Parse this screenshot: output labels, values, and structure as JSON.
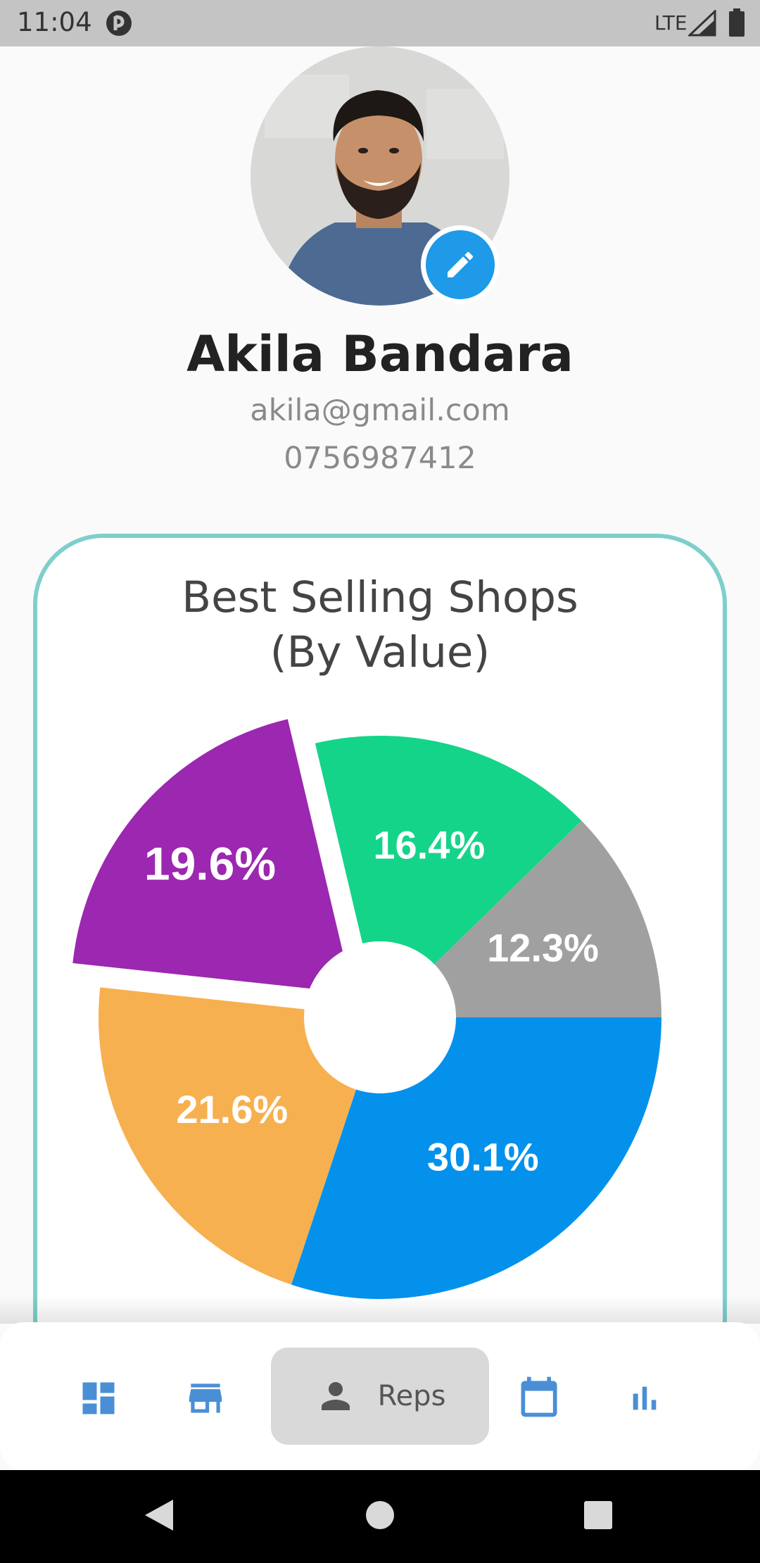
{
  "status_bar": {
    "time": "11:04",
    "network": "LTE"
  },
  "profile": {
    "name": "Akila Bandara",
    "email": "akila@gmail.com",
    "phone": "0756987412"
  },
  "chart": {
    "title_line1": "Best Selling Shops",
    "title_line2": "(By Value)"
  },
  "chart_data": {
    "type": "pie",
    "title": "Best Selling Shops (By Value)",
    "slices": [
      {
        "value": 30.1,
        "label": "30.1%",
        "color": "#0391ec"
      },
      {
        "value": 21.6,
        "label": "21.6%",
        "color": "#f7b04f"
      },
      {
        "value": 19.6,
        "label": "19.6%",
        "color": "#9c27b0",
        "exploded": true
      },
      {
        "value": 16.4,
        "label": "16.4%",
        "color": "#14d48a"
      },
      {
        "value": 12.3,
        "label": "12.3%",
        "color": "#a0a0a0"
      }
    ]
  },
  "bottom_nav": {
    "items": [
      {
        "icon": "dashboard-icon"
      },
      {
        "icon": "store-icon"
      },
      {
        "icon": "person-icon",
        "label": "Reps",
        "active": true
      },
      {
        "icon": "calendar-icon"
      },
      {
        "icon": "bar-chart-icon"
      }
    ]
  },
  "colors": {
    "accent": "#1e9ae8",
    "nav_icon": "#4a8fd6",
    "card_border": "#7ecfcc"
  }
}
